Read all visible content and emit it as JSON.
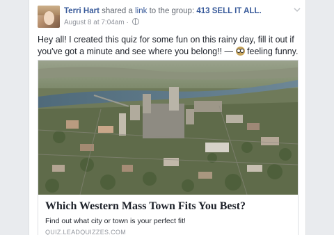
{
  "post": {
    "author": "Terri Hart",
    "action_prefix": "shared a",
    "link_word": "link",
    "action_suffix": "to the group:",
    "group": "413 SELL IT ALL.",
    "timestamp": "August 8 at 7:04am",
    "separator": "·",
    "body": "Hey all! I created this quiz for some fun on this rainy day, fill it out if you've got a minute and see where you belong!! —",
    "feeling": "feeling funny."
  },
  "attachment": {
    "title": "Which Western Mass Town Fits You Best?",
    "description": "Find out what city or town is your perfect fit!",
    "domain": "QUIZ.LEADQUIZZES.COM"
  },
  "icons": {
    "privacy": "globe-icon",
    "menu": "chevron-down-icon",
    "feeling": "owl-emoji-icon"
  },
  "colors": {
    "link_blue": "#365899",
    "meta_gray": "#90949c",
    "text": "#1d2129",
    "background": "#e9ebee"
  }
}
